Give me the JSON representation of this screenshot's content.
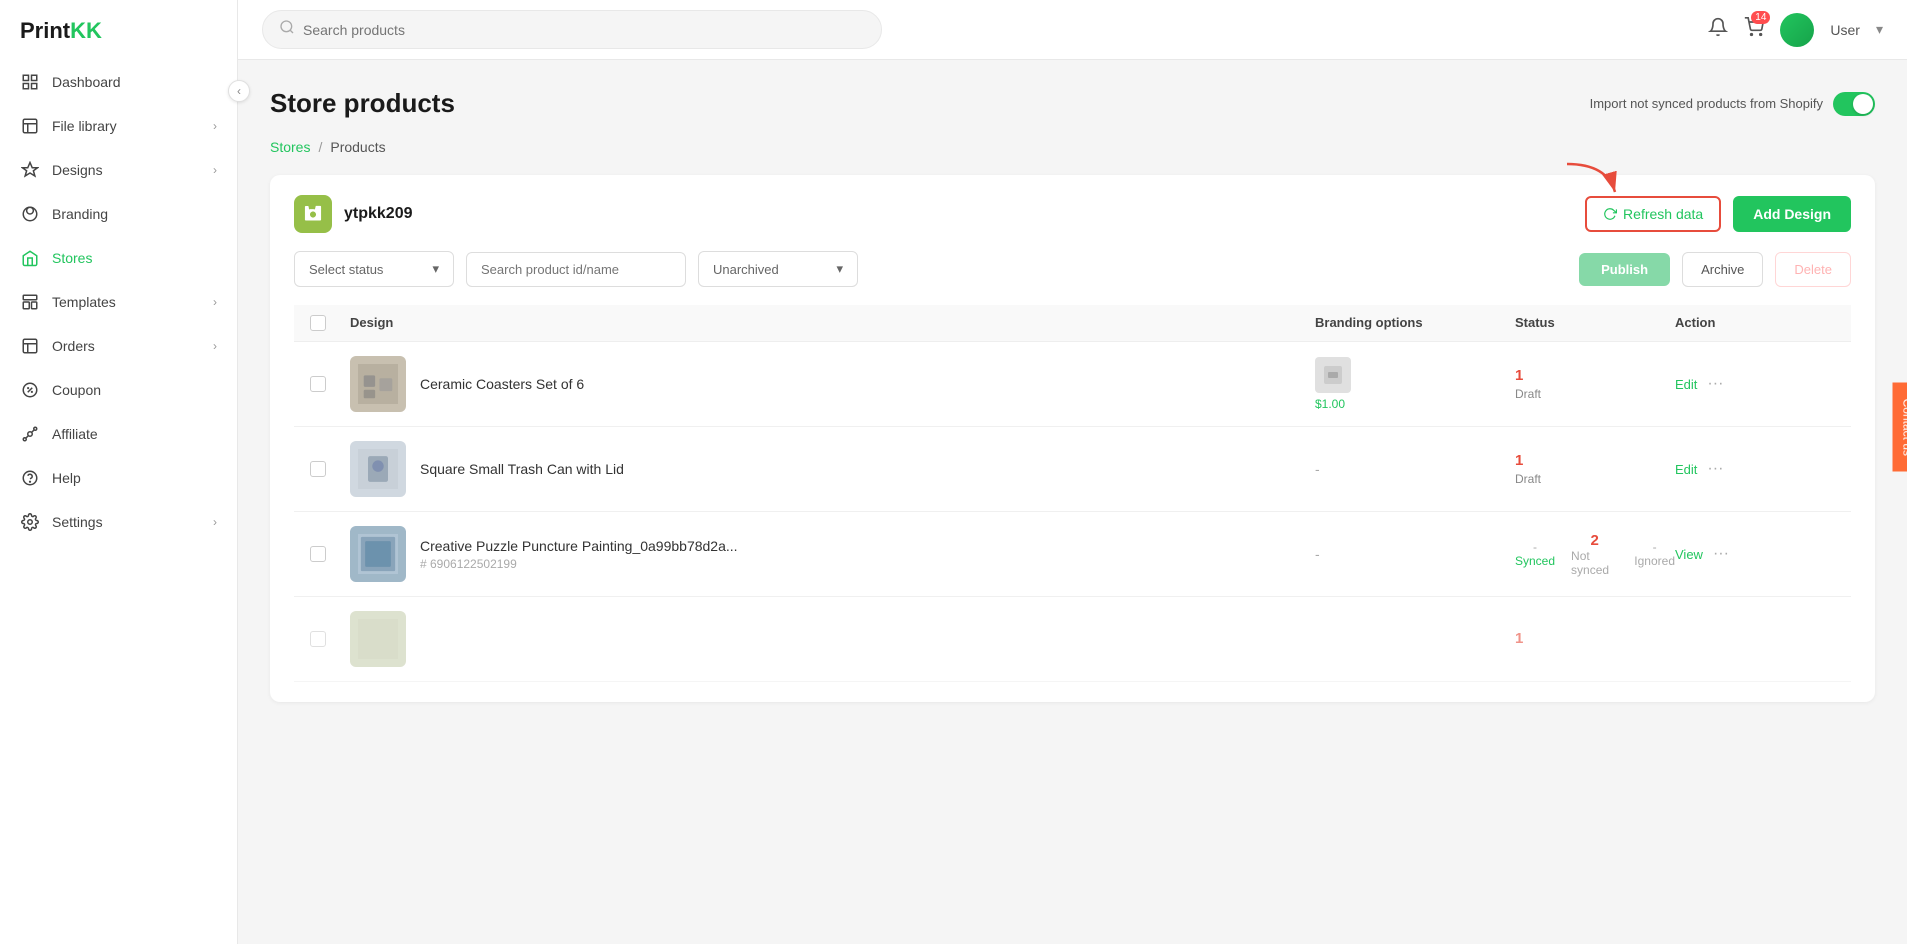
{
  "app": {
    "name": "Print",
    "name_accent": "KK"
  },
  "topbar": {
    "search_placeholder": "Search products",
    "notification_badge": "",
    "cart_badge": "14",
    "user_name": "User",
    "dropdown_label": "▾"
  },
  "page": {
    "title": "Store products",
    "import_toggle_label": "Import not synced products from Shopify"
  },
  "breadcrumb": {
    "stores": "Stores",
    "separator": "/",
    "products": "Products"
  },
  "store": {
    "icon": "S",
    "name": "ytpkk209",
    "refresh_label": "Refresh data",
    "add_design_label": "Add Design"
  },
  "filters": {
    "status_placeholder": "Select status",
    "search_placeholder": "Search product id/name",
    "archive_option": "Unarchived",
    "publish_label": "Publish",
    "archive_label": "Archive",
    "delete_label": "Delete"
  },
  "table": {
    "headers": [
      "",
      "Design",
      "Branding options",
      "Status",
      "Action"
    ],
    "rows": [
      {
        "id": "row1",
        "name": "Ceramic Coasters Set of 6",
        "product_id": "",
        "has_branding": true,
        "branding_price": "$1.00",
        "status_num": "1",
        "status_label": "Draft",
        "synced": null,
        "not_synced": null,
        "ignored": null,
        "action": "Edit"
      },
      {
        "id": "row2",
        "name": "Square Small Trash Can with Lid",
        "product_id": "",
        "has_branding": false,
        "branding_price": "",
        "status_num": "1",
        "status_label": "Draft",
        "synced": null,
        "not_synced": null,
        "ignored": null,
        "action": "Edit"
      },
      {
        "id": "row3",
        "name": "Creative Puzzle Puncture Painting_0a99bb78d2a...",
        "product_id": "# 6906122502199",
        "has_branding": false,
        "branding_price": "",
        "status_num": null,
        "status_label": null,
        "synced": "Synced",
        "synced_count": "",
        "not_synced": "Not synced",
        "not_synced_count": "2",
        "ignored": "Ignored",
        "action": "View"
      }
    ]
  },
  "contact_us": "Contact us"
}
